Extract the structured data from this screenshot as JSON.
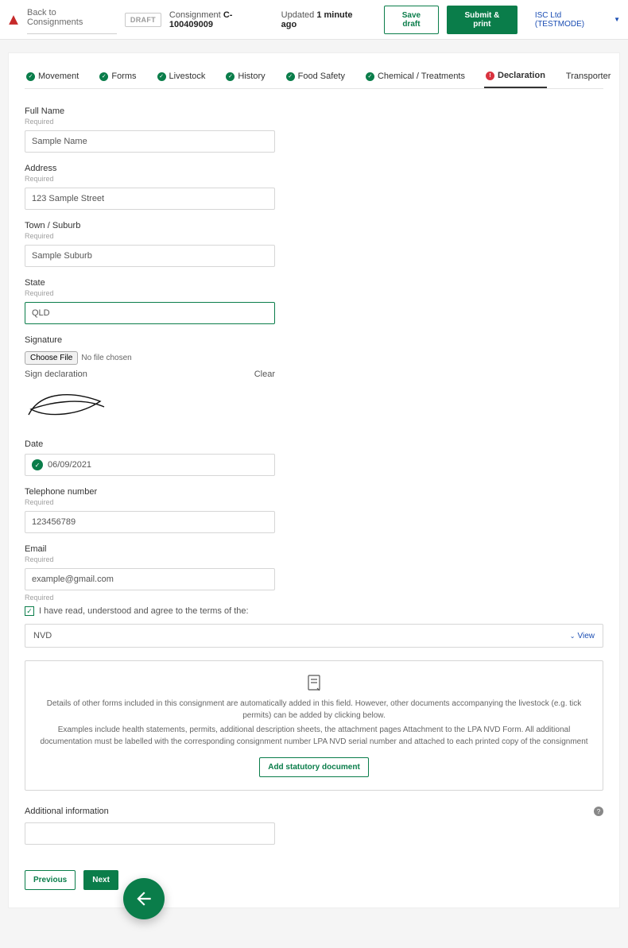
{
  "topbar": {
    "back_label": "Back to Consignments",
    "draft_badge": "DRAFT",
    "consignment_label": "Consignment",
    "consignment_number": "C-100409009",
    "updated_label": "Updated",
    "updated_value": "1 minute ago",
    "save_draft": "Save draft",
    "submit_print": "Submit & print",
    "user": "ISC Ltd (TESTMODE)"
  },
  "tabs": [
    {
      "label": "Movement",
      "status": "ok"
    },
    {
      "label": "Forms",
      "status": "ok"
    },
    {
      "label": "Livestock",
      "status": "ok"
    },
    {
      "label": "History",
      "status": "ok"
    },
    {
      "label": "Food Safety",
      "status": "ok"
    },
    {
      "label": "Chemical / Treatments",
      "status": "ok"
    },
    {
      "label": "Declaration",
      "status": "err",
      "active": true
    },
    {
      "label": "Transporter",
      "status": ""
    }
  ],
  "fields": {
    "full_name": {
      "label": "Full Name",
      "required": "Required",
      "value": "Sample Name"
    },
    "address": {
      "label": "Address",
      "required": "Required",
      "value": "123 Sample Street"
    },
    "town": {
      "label": "Town / Suburb",
      "required": "Required",
      "value": "Sample Suburb"
    },
    "state": {
      "label": "State",
      "required": "Required",
      "value": "QLD"
    },
    "signature": {
      "label": "Signature",
      "choose": "Choose File",
      "no_file": "No file chosen",
      "sign_label": "Sign declaration",
      "clear": "Clear"
    },
    "date": {
      "label": "Date",
      "value": "06/09/2021"
    },
    "telephone": {
      "label": "Telephone number",
      "required": "Required",
      "value": "123456789"
    },
    "email": {
      "label": "Email",
      "required": "Required",
      "value": "example@gmail.com",
      "trailing_required": "Required"
    }
  },
  "agree": {
    "text": "I have read, understood and agree to the terms of the:"
  },
  "nvd": {
    "label": "NVD",
    "view": "View"
  },
  "doc_panel": {
    "para1": "Details of other forms included in this consignment are automatically added in this field. However, other documents accompanying the livestock (e.g. tick permits) can be added by clicking below.",
    "para2": "Examples include health statements, permits, additional description sheets, the attachment pages Attachment to the LPA NVD Form. All additional documentation must be labelled with the corresponding consignment number LPA NVD serial number and attached to each printed copy of the consignment",
    "button": "Add statutory document"
  },
  "additional_info": {
    "label": "Additional information"
  },
  "nav": {
    "previous": "Previous",
    "next": "Next"
  }
}
